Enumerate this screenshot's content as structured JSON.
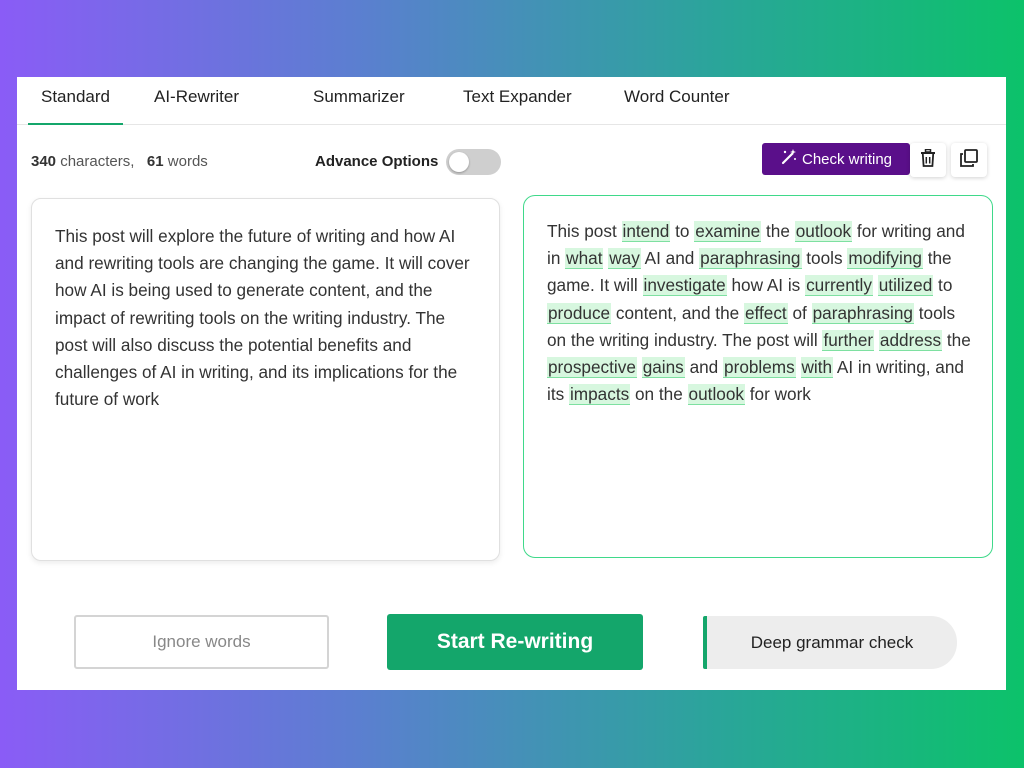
{
  "tabs": [
    {
      "label": "Standard",
      "active": true
    },
    {
      "label": "AI-Rewriter",
      "active": false
    },
    {
      "label": "Summarizer",
      "active": false
    },
    {
      "label": "Text Expander",
      "active": false
    },
    {
      "label": "Word Counter",
      "active": false
    }
  ],
  "stats": {
    "characters": "340",
    "characters_label": "characters,",
    "words": "61",
    "words_label": "words"
  },
  "advance_options": {
    "label": "Advance Options",
    "enabled": false
  },
  "toolbar": {
    "check_writing_label": "Check writing",
    "check_writing_icon": "magic-wand-icon",
    "delete_icon": "trash-icon",
    "copy_icon": "copy-icon"
  },
  "input_text": "This post will explore the future of writing and how AI and rewriting tools are changing the game. It will cover how AI is being used to generate content, and the impact of rewriting tools on the writing industry. The post will also discuss the potential benefits and challenges of AI in writing, and its implications for the future of work",
  "output_tokens": [
    {
      "t": "This post",
      "h": false
    },
    {
      "t": "intend",
      "h": true
    },
    {
      "t": "to",
      "h": false
    },
    {
      "t": "examine",
      "h": true
    },
    {
      "t": "the",
      "h": false
    },
    {
      "t": "outlook",
      "h": true
    },
    {
      "t": "for writing and in",
      "h": false
    },
    {
      "t": "what",
      "h": true
    },
    {
      "t": "way",
      "h": true
    },
    {
      "t": "AI and",
      "h": false
    },
    {
      "t": "paraphrasing",
      "h": true
    },
    {
      "t": "tools",
      "h": false
    },
    {
      "t": "modifying",
      "h": true
    },
    {
      "t": "the game. It will",
      "h": false
    },
    {
      "t": "investigate",
      "h": true
    },
    {
      "t": "how AI is",
      "h": false
    },
    {
      "t": "currently",
      "h": true
    },
    {
      "t": "utilized",
      "h": true
    },
    {
      "t": "to",
      "h": false
    },
    {
      "t": "produce",
      "h": true
    },
    {
      "t": "content, and the",
      "h": false
    },
    {
      "t": "effect",
      "h": true
    },
    {
      "t": "of",
      "h": false
    },
    {
      "t": "paraphrasing",
      "h": true
    },
    {
      "t": "tools on the writing industry. The post will",
      "h": false
    },
    {
      "t": "further",
      "h": true
    },
    {
      "t": "address",
      "h": true
    },
    {
      "t": "the",
      "h": false
    },
    {
      "t": "prospective",
      "h": true
    },
    {
      "t": "gains",
      "h": true
    },
    {
      "t": "and",
      "h": false
    },
    {
      "t": "problems",
      "h": true
    },
    {
      "t": "with",
      "h": true
    },
    {
      "t": "AI in writing, and its",
      "h": false
    },
    {
      "t": "impacts",
      "h": true
    },
    {
      "t": "on the",
      "h": false
    },
    {
      "t": "outlook",
      "h": true
    },
    {
      "t": "for work",
      "h": false
    }
  ],
  "buttons": {
    "ignore_words": "Ignore words",
    "start_rewriting": "Start Re-writing",
    "deep_grammar": "Deep grammar check"
  },
  "colors": {
    "accent": "#14a66b",
    "check_button": "#5a0f8a",
    "highlight_bg": "#d7f7df",
    "output_border": "#3fd98a"
  }
}
